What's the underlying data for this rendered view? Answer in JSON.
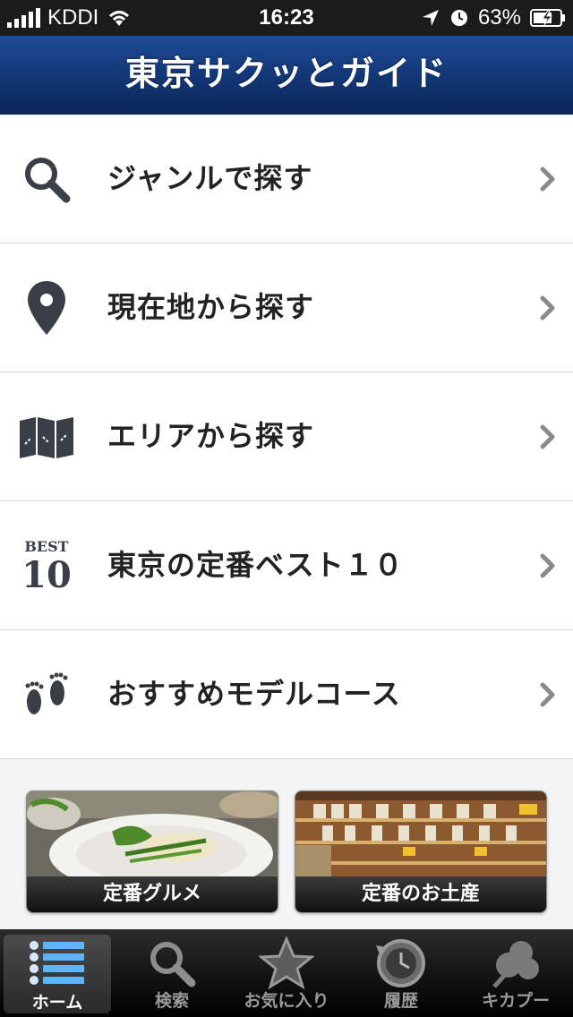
{
  "status_bar": {
    "carrier": "KDDI",
    "time": "16:23",
    "battery": "63%"
  },
  "header": {
    "title": "東京サクッとガイド"
  },
  "menu": [
    {
      "label": "ジャンルで探す",
      "icon": "search-icon"
    },
    {
      "label": "現在地から探す",
      "icon": "location-pin-icon"
    },
    {
      "label": "エリアから探す",
      "icon": "map-icon"
    },
    {
      "label": "東京の定番ベスト１０",
      "icon": "best10-icon",
      "icon_text_top": "BEST",
      "icon_text_bottom": "10"
    },
    {
      "label": "おすすめモデルコース",
      "icon": "footprints-icon"
    }
  ],
  "featured": [
    {
      "caption": "定番グルメ"
    },
    {
      "caption": "定番のお土産"
    }
  ],
  "tabs": [
    {
      "label": "ホーム",
      "icon": "list-icon",
      "active": true
    },
    {
      "label": "検索",
      "icon": "search-icon"
    },
    {
      "label": "お気に入り",
      "icon": "star-icon"
    },
    {
      "label": "履歴",
      "icon": "history-clock-icon"
    },
    {
      "label": "キカプー",
      "icon": "clover-icon"
    }
  ],
  "colors": {
    "header": "#14397a",
    "icon": "#3a3f47",
    "chevron": "#8a8a8a"
  }
}
